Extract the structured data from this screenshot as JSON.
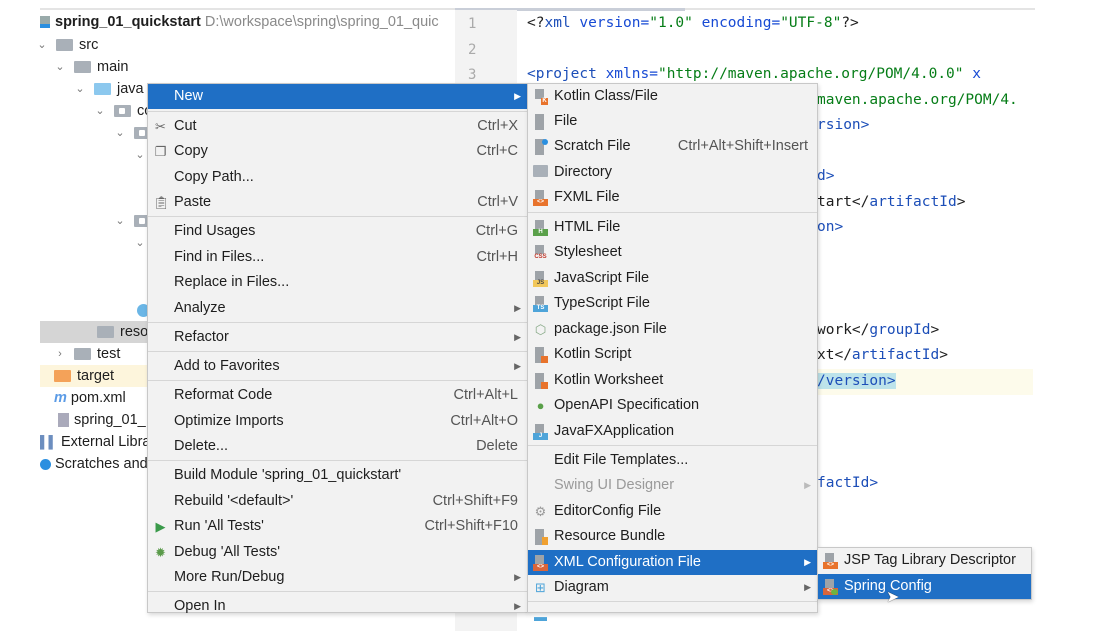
{
  "project": {
    "name": "spring_01_quickstart",
    "path": "D:\\workspace\\spring\\spring_01_quic",
    "nodes": [
      {
        "label": "src"
      },
      {
        "label": "main"
      },
      {
        "label": "java"
      },
      {
        "label": "co"
      },
      {
        "label": "reso"
      },
      {
        "label": "test"
      },
      {
        "label": "target"
      },
      {
        "label": "pom.xml"
      },
      {
        "label": "spring_01_"
      },
      {
        "label": "External Libra"
      },
      {
        "label": "Scratches and"
      }
    ]
  },
  "editor": {
    "line_numbers": [
      "1",
      "2",
      "3"
    ],
    "line1": {
      "a": "<?",
      "b": "xml ",
      "c": "version=",
      "d": "\"1.0\"",
      "e": " encoding=",
      "f": "\"UTF-8\"",
      "g": "?>"
    },
    "line3": {
      "a": "<project ",
      "b": "xmlns=",
      "c": "\"http://maven.apache.org/POM/4.0.0\"",
      "d": " x"
    },
    "fragments": [
      "maven.apache.org/POM/4.",
      "rsion>",
      "d>",
      "tart</",
      "artifactId",
      ">",
      "on>",
      "work</",
      "groupId",
      ">",
      "xt</",
      "artifactId",
      ">",
      "/version>",
      "factId>"
    ]
  },
  "context_menu": {
    "items": [
      {
        "label": "New"
      },
      {
        "label": "Cut",
        "shortcut": "Ctrl+X"
      },
      {
        "label": "Copy",
        "shortcut": "Ctrl+C"
      },
      {
        "label": "Copy Path..."
      },
      {
        "label": "Paste",
        "shortcut": "Ctrl+V"
      },
      {
        "label": "Find Usages",
        "shortcut": "Ctrl+G"
      },
      {
        "label": "Find in Files...",
        "shortcut": "Ctrl+H"
      },
      {
        "label": "Replace in Files..."
      },
      {
        "label": "Analyze"
      },
      {
        "label": "Refactor"
      },
      {
        "label": "Add to Favorites"
      },
      {
        "label": "Reformat Code",
        "shortcut": "Ctrl+Alt+L"
      },
      {
        "label": "Optimize Imports",
        "shortcut": "Ctrl+Alt+O"
      },
      {
        "label": "Delete...",
        "shortcut": "Delete"
      },
      {
        "label": "Build Module 'spring_01_quickstart'"
      },
      {
        "label": "Rebuild '<default>'",
        "shortcut": "Ctrl+Shift+F9"
      },
      {
        "label": "Run 'All Tests'",
        "shortcut": "Ctrl+Shift+F10"
      },
      {
        "label": "Debug 'All Tests'"
      },
      {
        "label": "More Run/Debug"
      },
      {
        "label": "Open In"
      }
    ]
  },
  "new_submenu": {
    "items": [
      {
        "label": "Kotlin Class/File"
      },
      {
        "label": "File"
      },
      {
        "label": "Scratch File",
        "shortcut": "Ctrl+Alt+Shift+Insert"
      },
      {
        "label": "Directory"
      },
      {
        "label": "FXML File",
        "badge": "<>"
      },
      {
        "label": "HTML File",
        "badge": "H"
      },
      {
        "label": "Stylesheet",
        "badge": "CSS"
      },
      {
        "label": "JavaScript File",
        "badge": "JS"
      },
      {
        "label": "TypeScript File",
        "badge": "TS"
      },
      {
        "label": "package.json File"
      },
      {
        "label": "Kotlin Script"
      },
      {
        "label": "Kotlin Worksheet"
      },
      {
        "label": "OpenAPI Specification"
      },
      {
        "label": "JavaFXApplication",
        "badge": "J"
      },
      {
        "label": "Edit File Templates..."
      },
      {
        "label": "Swing UI Designer"
      },
      {
        "label": "EditorConfig File"
      },
      {
        "label": "Resource Bundle"
      },
      {
        "label": "XML Configuration File",
        "badge": "<>"
      },
      {
        "label": "Diagram"
      }
    ]
  },
  "xml_submenu": {
    "items": [
      {
        "label": "JSP Tag Library Descriptor",
        "badge": "<>"
      },
      {
        "label": "Spring Config",
        "badge": "<>"
      }
    ]
  },
  "colors": {
    "selection": "#1f6fc5",
    "menu_bg": "#f2f2f2"
  }
}
